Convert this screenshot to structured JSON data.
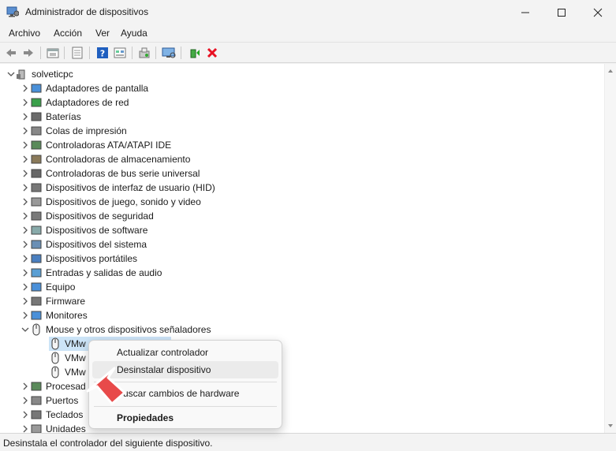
{
  "window": {
    "title": "Administrador de dispositivos",
    "controls": [
      "minimize-icon",
      "maximize-icon",
      "close-icon"
    ]
  },
  "menu": [
    "Archivo",
    "Acción",
    "Ver",
    "Ayuda"
  ],
  "toolbar": {
    "icons": [
      "back-arrow-icon",
      "forward-arrow-icon",
      "properties-sheet-icon",
      "print-list-icon",
      "help-icon",
      "view-grid-icon",
      "refresh-hardware-icon",
      "monitor-scan-icon",
      "update-driver-icon",
      "remove-device-icon"
    ],
    "accent_remove": "#e81123",
    "accent_help": "#1f5fbf"
  },
  "tree": {
    "root": "solveticpc",
    "categories": [
      "Adaptadores de pantalla",
      "Adaptadores de red",
      "Baterías",
      "Colas de impresión",
      "Controladoras ATA/ATAPI IDE",
      "Controladoras de almacenamiento",
      "Controladoras de bus serie universal",
      "Dispositivos de interfaz de usuario (HID)",
      "Dispositivos de juego, sonido y video",
      "Dispositivos de seguridad",
      "Dispositivos de software",
      "Dispositivos del sistema",
      "Dispositivos portátiles",
      "Entradas y salidas de audio",
      "Equipo",
      "Firmware",
      "Monitores",
      "Mouse y otros dispositivos señaladores"
    ],
    "mouse_children": [
      "VMw",
      "VMw",
      "VMw"
    ],
    "after_categories": [
      "Procesad",
      "Puertos",
      "Teclados",
      "Unidades"
    ]
  },
  "context_menu": {
    "items": [
      "Actualizar controlador",
      "Desinstalar dispositivo",
      "Buscar cambios de hardware",
      "Propiedades"
    ],
    "highlighted": "Desinstalar dispositivo"
  },
  "status": "Desinstala el controlador del siguiente dispositivo.",
  "colors": {
    "pointer": "#e84a4a",
    "selection": "#cce4f7"
  }
}
